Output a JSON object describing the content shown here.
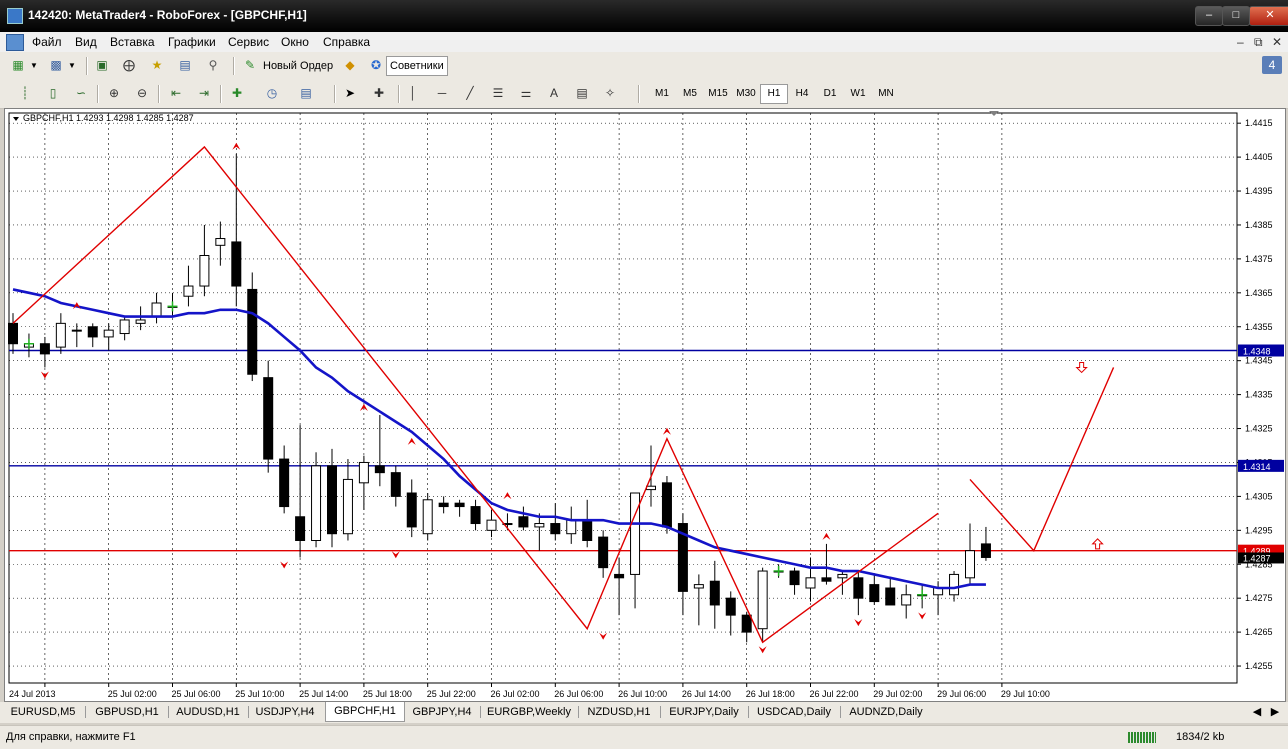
{
  "window": {
    "title": "142420: MetaTrader4 - RoboForex - [GBPCHF,H1]"
  },
  "menu": [
    "Файл",
    "Вид",
    "Вставка",
    "Графики",
    "Сервис",
    "Окно",
    "Справка"
  ],
  "toolbar": {
    "new_order_label": "Новый Ордер",
    "advisors_label": "Советники"
  },
  "timeframes": [
    "M1",
    "M5",
    "M15",
    "M30",
    "H1",
    "H4",
    "D1",
    "W1",
    "MN"
  ],
  "selected_timeframe": "H1",
  "chart_data": {
    "type": "candlestick",
    "symbol_info": "GBPCHF,H1  1.4293 1.4298 1.4285 1.4287",
    "symbol": "GBPCHF",
    "timeframe": "H1",
    "ohlc_header": {
      "open": 1.4293,
      "high": 1.4298,
      "low": 1.4285,
      "close": 1.4287
    },
    "ylim": [
      1.425,
      1.4418
    ],
    "y_ticks": [
      "1.4415",
      "1.4405",
      "1.4395",
      "1.4385",
      "1.4375",
      "1.4365",
      "1.4355",
      "1.4345",
      "1.4335",
      "1.4325",
      "1.4315",
      "1.4305",
      "1.4295",
      "1.4285",
      "1.4275",
      "1.4265",
      "1.4255"
    ],
    "x_ticks": [
      "24 Jul 2013",
      "25 Jul 02:00",
      "25 Jul 06:00",
      "25 Jul 10:00",
      "25 Jul 14:00",
      "25 Jul 18:00",
      "25 Jul 22:00",
      "26 Jul 02:00",
      "26 Jul 06:00",
      "26 Jul 10:00",
      "26 Jul 14:00",
      "26 Jul 18:00",
      "26 Jul 22:00",
      "29 Jul 02:00",
      "29 Jul 06:00",
      "29 Jul 10:00"
    ],
    "candles": [
      [
        1.4356,
        1.4359,
        1.4347,
        1.435
      ],
      [
        1.4349,
        1.4353,
        1.4346,
        1.435
      ],
      [
        1.435,
        1.4352,
        1.4343,
        1.4347
      ],
      [
        1.4349,
        1.4359,
        1.4347,
        1.4356
      ],
      [
        1.4354,
        1.4356,
        1.4349,
        1.4354
      ],
      [
        1.4355,
        1.4356,
        1.4349,
        1.4352
      ],
      [
        1.4352,
        1.4356,
        1.4348,
        1.4354
      ],
      [
        1.4353,
        1.4358,
        1.4351,
        1.4357
      ],
      [
        1.4356,
        1.4361,
        1.4354,
        1.4357
      ],
      [
        1.4358,
        1.4365,
        1.4356,
        1.4362
      ],
      [
        1.4361,
        1.4365,
        1.4358,
        1.4361
      ],
      [
        1.4364,
        1.4373,
        1.4361,
        1.4367
      ],
      [
        1.4367,
        1.4385,
        1.4364,
        1.4376
      ],
      [
        1.4379,
        1.4386,
        1.4373,
        1.4381
      ],
      [
        1.438,
        1.4406,
        1.4361,
        1.4367
      ],
      [
        1.4366,
        1.4371,
        1.4339,
        1.4341
      ],
      [
        1.434,
        1.4345,
        1.4312,
        1.4316
      ],
      [
        1.4316,
        1.432,
        1.43,
        1.4302
      ],
      [
        1.4299,
        1.4326,
        1.4287,
        1.4292
      ],
      [
        1.4292,
        1.4318,
        1.429,
        1.4314
      ],
      [
        1.4314,
        1.4319,
        1.429,
        1.4294
      ],
      [
        1.4294,
        1.4316,
        1.4292,
        1.431
      ],
      [
        1.4309,
        1.4317,
        1.4301,
        1.4315
      ],
      [
        1.4314,
        1.4329,
        1.4308,
        1.4312
      ],
      [
        1.4312,
        1.4314,
        1.4302,
        1.4305
      ],
      [
        1.4306,
        1.431,
        1.4293,
        1.4296
      ],
      [
        1.4294,
        1.4306,
        1.4292,
        1.4304
      ],
      [
        1.4303,
        1.4305,
        1.43,
        1.4302
      ],
      [
        1.4303,
        1.4304,
        1.4299,
        1.4302
      ],
      [
        1.4302,
        1.4304,
        1.4295,
        1.4297
      ],
      [
        1.4295,
        1.4301,
        1.4293,
        1.4298
      ],
      [
        1.4297,
        1.43,
        1.4295,
        1.4297
      ],
      [
        1.4299,
        1.4302,
        1.4295,
        1.4296
      ],
      [
        1.4296,
        1.43,
        1.4289,
        1.4297
      ],
      [
        1.4297,
        1.4303,
        1.4292,
        1.4294
      ],
      [
        1.4294,
        1.4302,
        1.4291,
        1.4298
      ],
      [
        1.4298,
        1.4304,
        1.429,
        1.4292
      ],
      [
        1.4293,
        1.4295,
        1.4281,
        1.4284
      ],
      [
        1.4282,
        1.4287,
        1.427,
        1.4281
      ],
      [
        1.4282,
        1.4303,
        1.4272,
        1.4306
      ],
      [
        1.4307,
        1.432,
        1.4302,
        1.4308
      ],
      [
        1.4309,
        1.4311,
        1.4294,
        1.4296
      ],
      [
        1.4297,
        1.43,
        1.427,
        1.4277
      ],
      [
        1.4278,
        1.4282,
        1.4267,
        1.4279
      ],
      [
        1.428,
        1.4286,
        1.4266,
        1.4273
      ],
      [
        1.4275,
        1.4277,
        1.4264,
        1.427
      ],
      [
        1.427,
        1.4271,
        1.4262,
        1.4265
      ],
      [
        1.4266,
        1.4284,
        1.4262,
        1.4283
      ],
      [
        1.4283,
        1.4285,
        1.4281,
        1.4283
      ],
      [
        1.4283,
        1.4284,
        1.4276,
        1.4279
      ],
      [
        1.4278,
        1.4287,
        1.4274,
        1.4281
      ],
      [
        1.4281,
        1.4291,
        1.4279,
        1.428
      ],
      [
        1.4281,
        1.4283,
        1.4276,
        1.4282
      ],
      [
        1.4281,
        1.4283,
        1.427,
        1.4275
      ],
      [
        1.4279,
        1.4282,
        1.4273,
        1.4274
      ],
      [
        1.4278,
        1.4281,
        1.4274,
        1.4273
      ],
      [
        1.4273,
        1.4279,
        1.4269,
        1.4276
      ],
      [
        1.4276,
        1.4279,
        1.4272,
        1.4276
      ],
      [
        1.4276,
        1.428,
        1.427,
        1.4278
      ],
      [
        1.4276,
        1.4283,
        1.4274,
        1.4282
      ],
      [
        1.4281,
        1.4297,
        1.4279,
        1.4289
      ],
      [
        1.4291,
        1.4296,
        1.4286,
        1.4287
      ]
    ],
    "moving_average": [
      1.4366,
      1.4365,
      1.4364,
      1.4362,
      1.4361,
      1.436,
      1.4359,
      1.4358,
      1.4358,
      1.4358,
      1.4358,
      1.4359,
      1.4359,
      1.436,
      1.436,
      1.4359,
      1.4356,
      1.4352,
      1.4348,
      1.4343,
      1.434,
      1.4336,
      1.4333,
      1.433,
      1.4327,
      1.4324,
      1.432,
      1.4316,
      1.4311,
      1.4307,
      1.4303,
      1.4301,
      1.43,
      1.4299,
      1.4299,
      1.4298,
      1.4298,
      1.4298,
      1.4297,
      1.4297,
      1.4297,
      1.4296,
      1.4294,
      1.4292,
      1.429,
      1.4289,
      1.4288,
      1.4287,
      1.4286,
      1.4285,
      1.4284,
      1.4284,
      1.4283,
      1.4283,
      1.4282,
      1.4281,
      1.428,
      1.4279,
      1.4278,
      1.4278,
      1.4279,
      1.4279
    ],
    "zigzag": [
      [
        0,
        1.4356
      ],
      [
        12,
        1.4408
      ],
      [
        36,
        1.4266
      ],
      [
        41,
        1.4322
      ],
      [
        47,
        1.4262
      ],
      [
        58,
        1.43
      ]
    ],
    "projection": [
      [
        60,
        1.431
      ],
      [
        64,
        1.4289
      ],
      [
        69,
        1.4343
      ]
    ],
    "hlines": [
      {
        "value": 1.4348,
        "label": "1.4348",
        "color": "#0000a0"
      },
      {
        "value": 1.4314,
        "label": "1.4314",
        "color": "#0000a0"
      },
      {
        "value": 1.4289,
        "label": "1.4289",
        "color": "#e00000"
      }
    ],
    "current_price_label": "1.4287",
    "colors": {
      "bull": "#ffffff",
      "bear": "#000000",
      "ma": "#1414c8",
      "zigzag": "#e00000",
      "grid": "#000000"
    },
    "grid": true
  },
  "tabs": [
    "EURUSD,M5",
    "GBPUSD,H1",
    "AUDUSD,H1",
    "USDJPY,H4",
    "GBPCHF,H1",
    "GBPJPY,H4",
    "EURGBP,Weekly",
    "NZDUSD,H1",
    "EURJPY,Daily",
    "USDCAD,Daily",
    "AUDNZD,Daily"
  ],
  "active_tab": "GBPCHF,H1",
  "status": {
    "help": "Для справки, нажмите F1",
    "traffic": "1834/2 kb"
  }
}
